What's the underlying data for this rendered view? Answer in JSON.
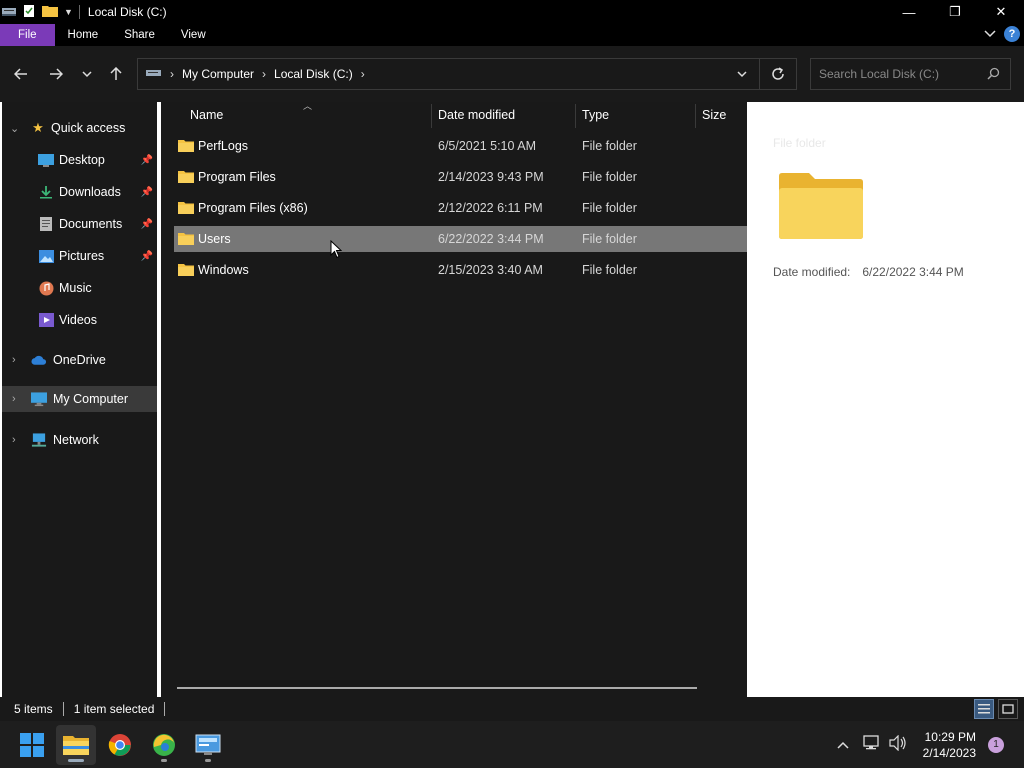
{
  "window": {
    "title": "Local Disk (C:)",
    "controls": {
      "minimize": "—",
      "maximize": "❐",
      "close": "✕"
    }
  },
  "ribbon": {
    "tabs": [
      {
        "label": "File",
        "active": true
      },
      {
        "label": "Home"
      },
      {
        "label": "Share"
      },
      {
        "label": "View"
      }
    ],
    "help": "?"
  },
  "address": {
    "crumbs": [
      "My Computer",
      "Local Disk (C:)"
    ],
    "search_placeholder": "Search Local Disk (C:)"
  },
  "nav_pane": {
    "items": [
      {
        "label": "Quick access",
        "icon": "star-icon"
      },
      {
        "label": "Desktop",
        "icon": "desktop-icon",
        "pinned": true
      },
      {
        "label": "Downloads",
        "icon": "download-icon",
        "pinned": true
      },
      {
        "label": "Documents",
        "icon": "document-icon",
        "pinned": true
      },
      {
        "label": "Pictures",
        "icon": "pictures-icon",
        "pinned": true
      },
      {
        "label": "Music",
        "icon": "music-icon"
      },
      {
        "label": "Videos",
        "icon": "videos-icon"
      },
      {
        "label": "OneDrive",
        "icon": "cloud-icon"
      },
      {
        "label": "My Computer",
        "icon": "computer-icon",
        "selected": true
      },
      {
        "label": "Network",
        "icon": "network-icon"
      }
    ]
  },
  "file_list": {
    "columns": [
      "Name",
      "Date modified",
      "Type",
      "Size"
    ],
    "rows": [
      {
        "name": "PerfLogs",
        "date": "6/5/2021 5:10 AM",
        "type": "File folder",
        "size": ""
      },
      {
        "name": "Program Files",
        "date": "2/14/2023 9:43 PM",
        "type": "File folder",
        "size": ""
      },
      {
        "name": "Program Files (x86)",
        "date": "2/12/2022 6:11 PM",
        "type": "File folder",
        "size": ""
      },
      {
        "name": "Users",
        "date": "6/22/2022 3:44 PM",
        "type": "File folder",
        "size": "",
        "selected": true
      },
      {
        "name": "Windows",
        "date": "2/15/2023 3:40 AM",
        "type": "File folder",
        "size": ""
      }
    ]
  },
  "preview": {
    "type_label": "File folder",
    "meta_label": "Date modified:",
    "meta_value": "6/22/2022 3:44 PM"
  },
  "status_bar": {
    "item_count": "5 items",
    "selection": "1 item selected"
  },
  "taskbar": {
    "apps": [
      {
        "name": "start-button"
      },
      {
        "name": "file-explorer-app",
        "active": true
      },
      {
        "name": "chrome-app"
      },
      {
        "name": "edge-app"
      },
      {
        "name": "control-panel-app"
      }
    ],
    "time": "10:29 PM",
    "date": "2/14/2023",
    "notifications": "1"
  },
  "colors": {
    "accent_file_tab": "#7b3ab8",
    "folder_yellow": "#f5c342",
    "selection_row": "#777777"
  }
}
